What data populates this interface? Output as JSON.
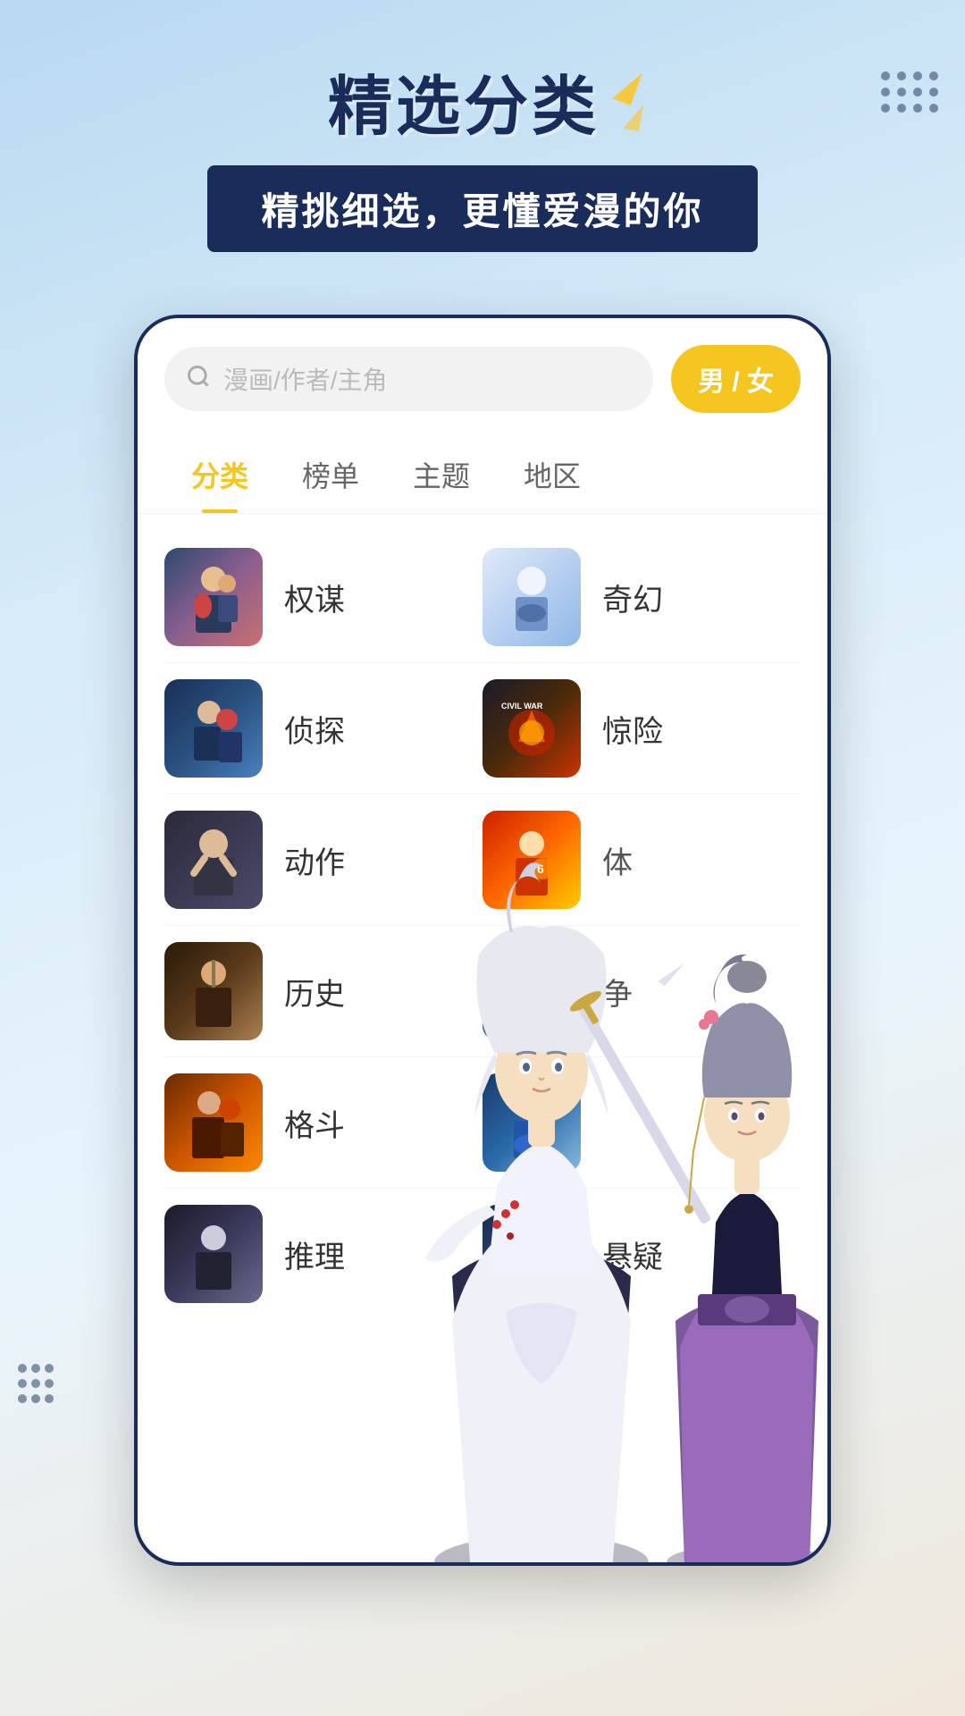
{
  "header": {
    "title": "精选分类",
    "subtitle": "精挑细选，更懂爱漫的你"
  },
  "search": {
    "placeholder": "漫画/作者/主角",
    "gender_toggle": "男 / 女"
  },
  "tabs": [
    {
      "id": "category",
      "label": "分类",
      "active": true
    },
    {
      "id": "ranking",
      "label": "榜单",
      "active": false
    },
    {
      "id": "theme",
      "label": "主题",
      "active": false
    },
    {
      "id": "region",
      "label": "地区",
      "active": false
    }
  ],
  "categories": [
    {
      "id": "quanmou",
      "label": "权谋",
      "thumb_color1": "#2c4a6e",
      "thumb_color2": "#8b5e8e"
    },
    {
      "id": "qihuan",
      "label": "奇幻",
      "thumb_color1": "#c8d8f0",
      "thumb_color2": "#a0c0e8"
    },
    {
      "id": "zhentan",
      "label": "侦探",
      "thumb_color1": "#1a3055",
      "thumb_color2": "#4a80c0"
    },
    {
      "id": "jingxian",
      "label": "惊险",
      "thumb_color1": "#8b1a1a",
      "thumb_color2": "#ffaa00"
    },
    {
      "id": "dongzuo",
      "label": "动作",
      "thumb_color1": "#2a2a3a",
      "thumb_color2": "#4a4a6a"
    },
    {
      "id": "tiyu",
      "label": "体",
      "thumb_color1": "#cc3333",
      "thumb_color2": "#ffcc00"
    },
    {
      "id": "lishi",
      "label": "历史",
      "thumb_color1": "#2a1a0a",
      "thumb_color2": "#aa8050"
    },
    {
      "id": "zhan",
      "label": "争",
      "thumb_color1": "#1a3a6a",
      "thumb_color2": "#88bbdd"
    },
    {
      "id": "gedou",
      "label": "格斗",
      "thumb_color1": "#8b3a00",
      "thumb_color2": "#ff9900"
    },
    {
      "id": "gedou2",
      "label": "",
      "thumb_color1": "#1a3a6a",
      "thumb_color2": "#88bbdd"
    },
    {
      "id": "tuili",
      "label": "推理",
      "thumb_color1": "#1a1a2a",
      "thumb_color2": "#6a6a8a"
    },
    {
      "id": "yiyi",
      "label": "悬疑",
      "thumb_color1": "#1a2a4a",
      "thumb_color2": "#6a8aaa"
    }
  ],
  "colors": {
    "primary_dark": "#1a2d5a",
    "accent_yellow": "#f5c520",
    "background_light": "#b8d9f0",
    "tab_active": "#f5c520"
  }
}
